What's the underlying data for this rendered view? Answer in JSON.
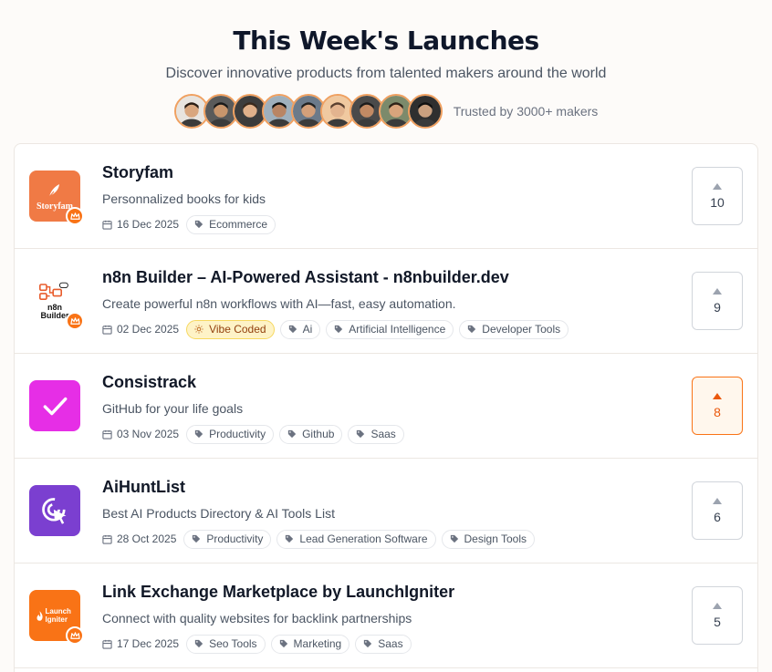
{
  "header": {
    "title": "This Week's Launches",
    "subtitle": "Discover innovative products from talented makers around the world",
    "trust_text": "Trusted by 3000+ makers",
    "avatar_count": 9
  },
  "products": [
    {
      "name": "Storyfam",
      "description": "Personnalized books for kids",
      "date": "16 Dec 2025",
      "logo_text": "Storyfam",
      "logo_color": "#f07a45",
      "premium": true,
      "vibe_coded": null,
      "tags": [
        "Ecommerce"
      ],
      "votes": "10",
      "voted": false
    },
    {
      "name": "n8n Builder – AI-Powered Assistant - n8nbuilder.dev",
      "description": "Create powerful n8n workflows with AI—fast, easy automation.",
      "date": "02 Dec 2025",
      "logo_text": "n8n Builder",
      "logo_color": "#ffffff",
      "premium": true,
      "vibe_coded": "Vibe Coded",
      "tags": [
        "Ai",
        "Artificial Intelligence",
        "Developer Tools"
      ],
      "votes": "9",
      "voted": false
    },
    {
      "name": "Consistrack",
      "description": "GitHub for your life goals",
      "date": "03 Nov 2025",
      "logo_text": "",
      "logo_color": "#e62ee6",
      "premium": false,
      "vibe_coded": null,
      "tags": [
        "Productivity",
        "Github",
        "Saas"
      ],
      "votes": "8",
      "voted": true
    },
    {
      "name": "AiHuntList",
      "description": "Best AI Products Directory & AI Tools List",
      "date": "28 Oct 2025",
      "logo_text": "",
      "logo_color": "#7b3fd0",
      "premium": false,
      "vibe_coded": null,
      "tags": [
        "Productivity",
        "Lead Generation Software",
        "Design Tools"
      ],
      "votes": "6",
      "voted": false
    },
    {
      "name": "Link Exchange Marketplace by LaunchIgniter",
      "description": "Connect with quality websites for backlink partnerships",
      "date": "17 Dec 2025",
      "logo_text": "Launch Igniter",
      "logo_color": "#f97316",
      "premium": true,
      "vibe_coded": null,
      "tags": [
        "Seo Tools",
        "Marketing",
        "Saas"
      ],
      "votes": "5",
      "voted": false
    }
  ]
}
